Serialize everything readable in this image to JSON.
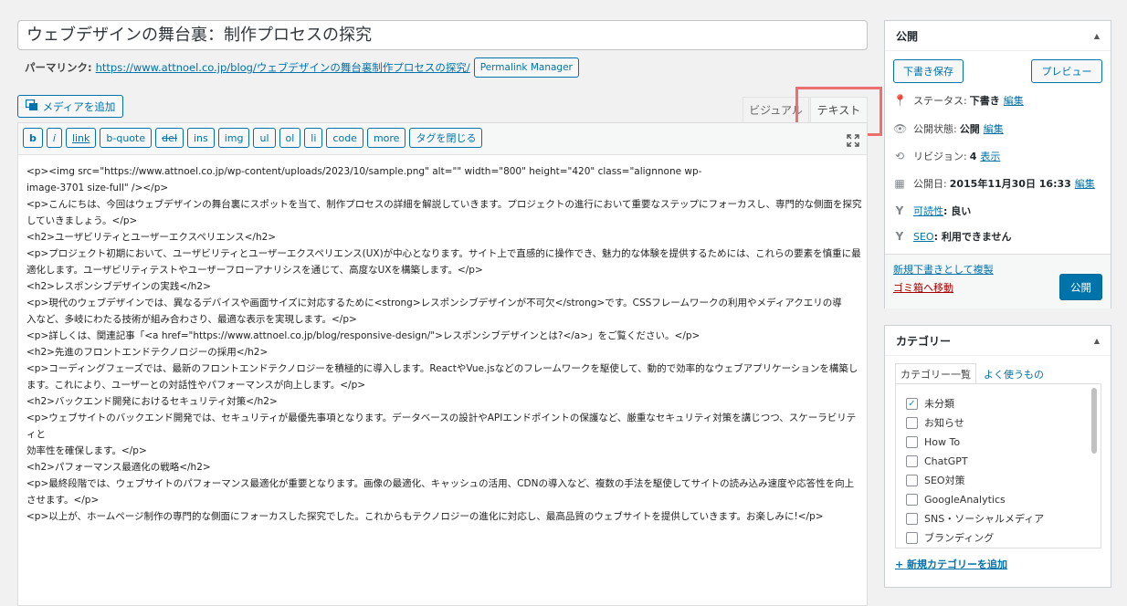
{
  "post": {
    "title": "ウェブデザインの舞台裏：制作プロセスの探究"
  },
  "permalink": {
    "label": "パーマリンク:",
    "url": "https://www.attnoel.co.jp/blog/ウェブデザインの舞台裏制作プロセスの探究/",
    "manager_button": "Permalink Manager"
  },
  "editor": {
    "add_media": "メディアを追加",
    "tabs": {
      "visual": "ビジュアル",
      "text": "テキスト"
    },
    "quicktags": [
      "b",
      "i",
      "link",
      "b-quote",
      "del",
      "ins",
      "img",
      "ul",
      "ol",
      "li",
      "code",
      "more",
      "タグを閉じる"
    ],
    "content_lines": [
      "<p><img src=\"https://www.attnoel.co.jp/wp-content/uploads/2023/10/sample.png\" alt=\"\" width=\"800\" height=\"420\" class=\"alignnone wp-",
      "image-3701 size-full\" /></p>",
      "<p>こんにちは、今回はウェブデザインの舞台裏にスポットを当て、制作プロセスの詳細を解説していきます。プロジェクトの進行において重要なステップにフォーカスし、専門的な側面を探究",
      "していきましょう。</p>",
      "<h2>ユーザビリティとユーザーエクスペリエンス</h2>",
      "<p>プロジェクト初期において、ユーザビリティとユーザーエクスペリエンス(UX)が中心となります。サイト上で直感的に操作でき、魅力的な体験を提供するためには、これらの要素を慎重に最",
      "適化します。ユーザビリティテストやユーザーフローアナリシスを通じて、高度なUXを構築します。</p>",
      "<h2>レスポンシブデザインの実践</h2>",
      "<p>現代のウェブデザインでは、異なるデバイスや画面サイズに対応するために<strong>レスポンシブデザインが不可欠</strong>です。CSSフレームワークの利用やメディアクエリの導",
      "入など、多岐にわたる技術が組み合わさり、最適な表示を実現します。</p>",
      "<p>詳しくは、関連記事「<a href=\"https://www.attnoel.co.jp/blog/responsive-design/\">レスポンシブデザインとは?</a>」をご覧ください。</p>",
      "<h2>先進のフロントエンドテクノロジーの採用</h2>",
      "<p>コーディングフェーズでは、最新のフロントエンドテクノロジーを積極的に導入します。ReactやVue.jsなどのフレームワークを駆使して、動的で効率的なウェブアプリケーションを構築し",
      "ます。これにより、ユーザーとの対話性やパフォーマンスが向上します。</p>",
      "<h2>バックエンド開発におけるセキュリティ対策</h2>",
      "<p>ウェブサイトのバックエンド開発では、セキュリティが最優先事項となります。データベースの設計やAPIエンドポイントの保護など、厳重なセキュリティ対策を講じつつ、スケーラビリティと",
      "効率性を確保します。</p>",
      "<h2>パフォーマンス最適化の戦略</h2>",
      "<p>最終段階では、ウェブサイトのパフォーマンス最適化が重要となります。画像の最適化、キャッシュの活用、CDNの導入など、複数の手法を駆使してサイトの読み込み速度や応答性を向上",
      "させます。</p>",
      "<p>以上が、ホームページ制作の専門的な側面にフォーカスした探究でした。これからもテクノロジーの進化に対応し、最高品質のウェブサイトを提供していきます。お楽しみに!</p>"
    ]
  },
  "publish": {
    "title": "公開",
    "save_draft": "下書き保存",
    "preview": "プレビュー",
    "status_label": "ステータス:",
    "status_value": "下書き",
    "visibility_label": "公開状態:",
    "visibility_value": "公開",
    "revisions_label": "リビジョン:",
    "revisions_value": "4",
    "revisions_link": "表示",
    "date_label": "公開日:",
    "date_value": "2015年11月30日 16:33",
    "edit": "編集",
    "readability_link": "可読性",
    "readability_value": ": 良い",
    "seo_link": "SEO",
    "seo_value": ": 利用できません",
    "copy_draft": "新規下書きとして複製",
    "trash": "ゴミ箱へ移動",
    "publish_button": "公開"
  },
  "categories": {
    "title": "カテゴリー",
    "tab_all": "カテゴリー一覧",
    "tab_popular": "よく使うもの",
    "items": [
      {
        "label": "未分類",
        "checked": true
      },
      {
        "label": "お知らせ",
        "checked": false
      },
      {
        "label": "How To",
        "checked": false
      },
      {
        "label": "ChatGPT",
        "checked": false
      },
      {
        "label": "SEO対策",
        "checked": false
      },
      {
        "label": "GoogleAnalytics",
        "checked": false
      },
      {
        "label": "SNS・ソーシャルメディア",
        "checked": false
      },
      {
        "label": "ブランディング",
        "checked": false
      }
    ],
    "add_new": "+ 新規カテゴリーを追加"
  },
  "colors": {
    "accent": "#0073aa",
    "highlight": "#ee6f6f",
    "trash": "#a00000",
    "yoast_green": "#77b227"
  }
}
